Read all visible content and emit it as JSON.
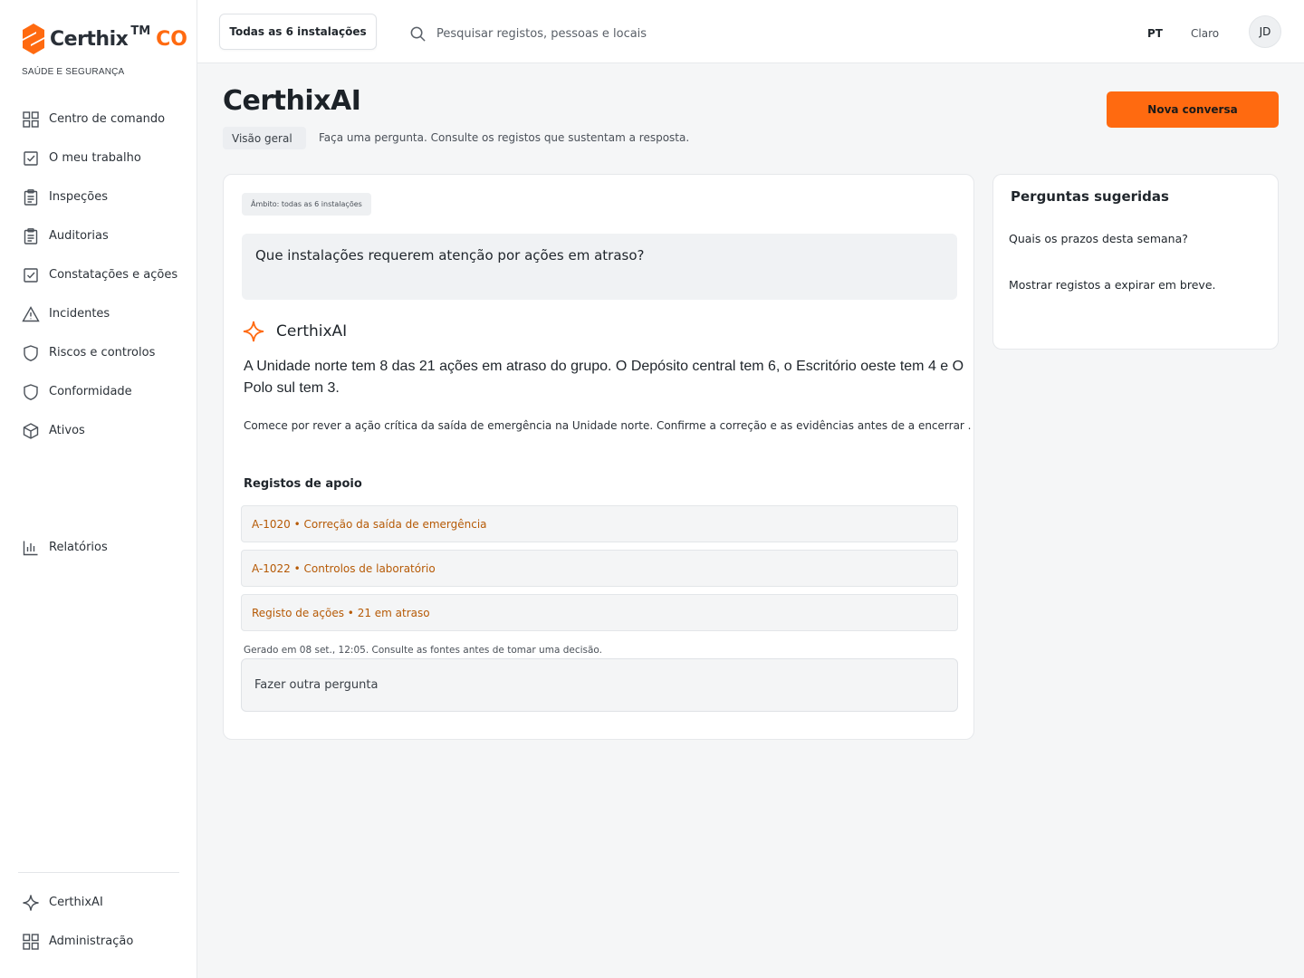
{
  "brand": {
    "name": "Certhix",
    "tm": "TM",
    "suffix": "CO",
    "subtitle": "SAÚDE E SEGURANÇA",
    "accent_color": "#ff6a10"
  },
  "sidebar": {
    "items": [
      {
        "label": "Centro de comando",
        "icon": "grid-icon"
      },
      {
        "label": "O meu trabalho",
        "icon": "checkbox-icon"
      },
      {
        "label": "Inspeções",
        "icon": "clipboard-icon"
      },
      {
        "label": "Auditorias",
        "icon": "clipboard-icon"
      },
      {
        "label": "Constatações e ações",
        "icon": "checkbox-icon"
      },
      {
        "label": "Incidentes",
        "icon": "warning-icon"
      },
      {
        "label": "Riscos e controlos",
        "icon": "shield-icon"
      },
      {
        "label": "Conformidade",
        "icon": "shield-icon"
      },
      {
        "label": "Ativos",
        "icon": "cube-icon"
      }
    ],
    "reports": {
      "label": "Relatórios",
      "icon": "bar-chart-icon"
    },
    "bottom": [
      {
        "label": "CerthixAI",
        "icon": "sparkle-icon"
      },
      {
        "label": "Administração",
        "icon": "grid-icon"
      }
    ]
  },
  "topbar": {
    "site_selector": "Todas as 6 instalações",
    "search_placeholder": "Pesquisar registos, pessoas e locais",
    "language": "PT",
    "theme": "Claro",
    "avatar_initials": "JD"
  },
  "page": {
    "title": "CerthixAI",
    "breadcrumb": "Visão geral",
    "subtitle": "Faça uma pergunta. Consulte os registos que sustentam a resposta.",
    "new_button": "Nova conversa"
  },
  "chat": {
    "scope": "Âmbito: todas as 6 instalações",
    "question": "Que instalações requerem atenção por ações em atraso?",
    "assistant_name": "CerthixAI",
    "answer": "A Unidade norte tem 8 das 21 ações em atraso do grupo. O Depósito central tem 6, o Escritório oeste tem 4 e O Polo sul tem 3.",
    "advice": "Comece por rever a ação crítica da saída de emergência na Unidade norte. Confirme a correção e as evidências antes de a encerrar .",
    "support_title": "Registos de apoio",
    "records": [
      "A-1020 • Correção da saída de emergência",
      "A-1022 • Controlos de laboratório",
      "Registo de ações • 21 em atraso"
    ],
    "generated_note": "Gerado em 08 set., 12:05. Consulte as fontes antes de tomar uma decisão.",
    "ask_placeholder": "Fazer outra pergunta"
  },
  "suggestions": {
    "title": "Perguntas sugeridas",
    "items": [
      "Quais os prazos desta semana?",
      "Mostrar registos a expirar em breve."
    ]
  }
}
